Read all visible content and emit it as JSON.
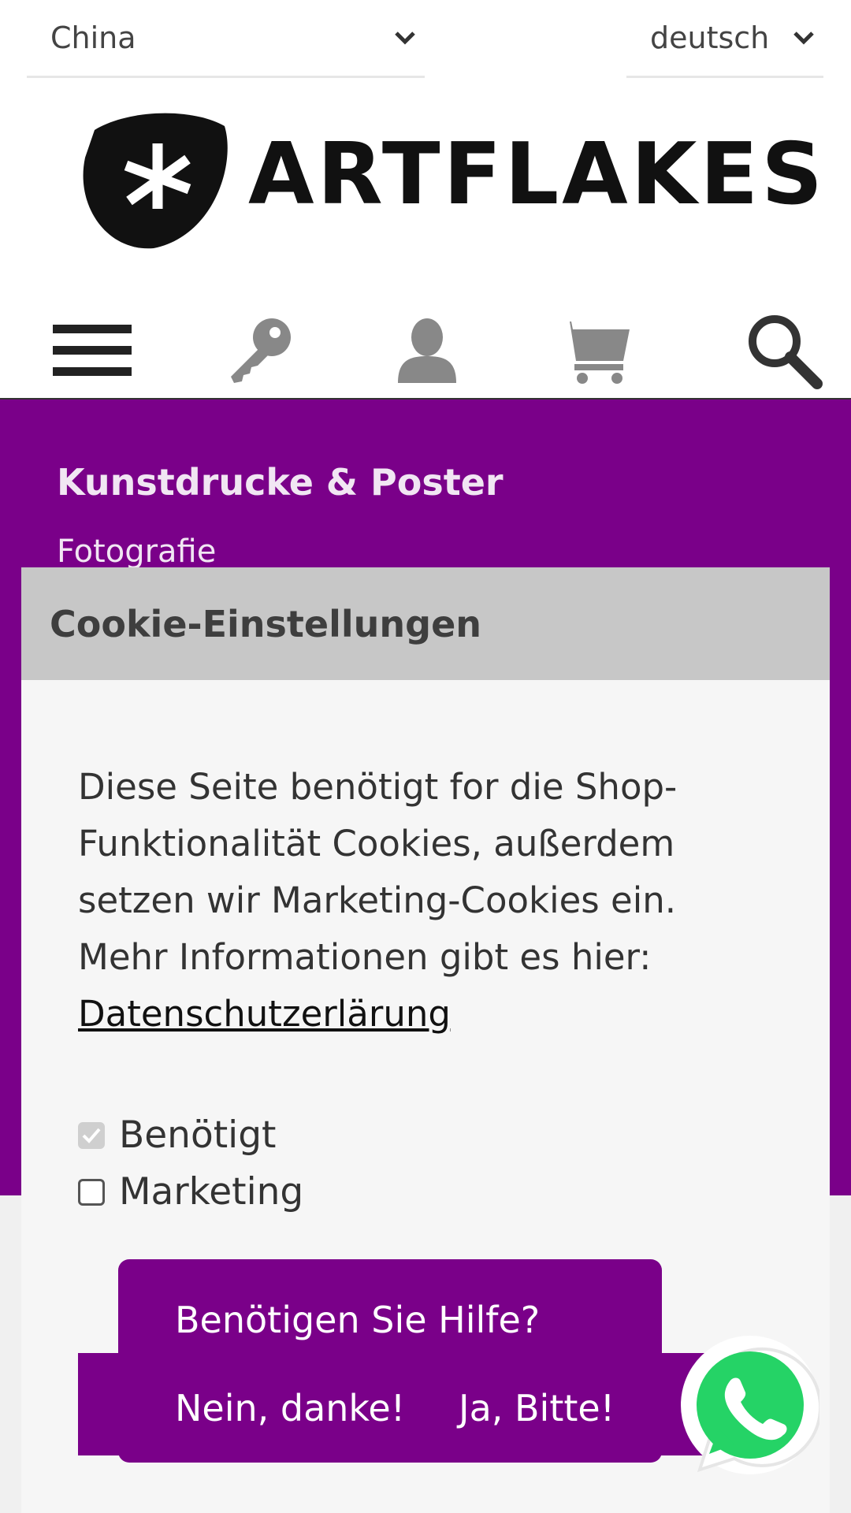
{
  "topbar": {
    "country": "China",
    "language": "deutsch"
  },
  "logo": {
    "text": "ARTFLAKES"
  },
  "icons": [
    "menu-icon",
    "key-icon",
    "user-icon",
    "cart-icon",
    "search-icon"
  ],
  "hero": {
    "category": "Kunstdrucke & Poster",
    "subcategory": "Fotografie"
  },
  "cookie": {
    "title": "Cookie-Einstellungen",
    "text": "Diese Seite benötigt for die Shop-Funktionalität Cookies, außerdem setzen wir Marketing-Cookies ein. Mehr Informationen gibt es hier:",
    "link": "Datenschutzerlärung",
    "options": [
      {
        "label": "Benötigt",
        "checked": true,
        "disabled": true
      },
      {
        "label": "Marketing",
        "checked": false,
        "disabled": false
      }
    ]
  },
  "help": {
    "question": "Benötigen Sie Hilfe?",
    "no": "Nein, danke!",
    "yes": "Ja, Bitte!"
  },
  "colors": {
    "brand_purple": "#7a0089",
    "whatsapp_green": "#25d366"
  }
}
